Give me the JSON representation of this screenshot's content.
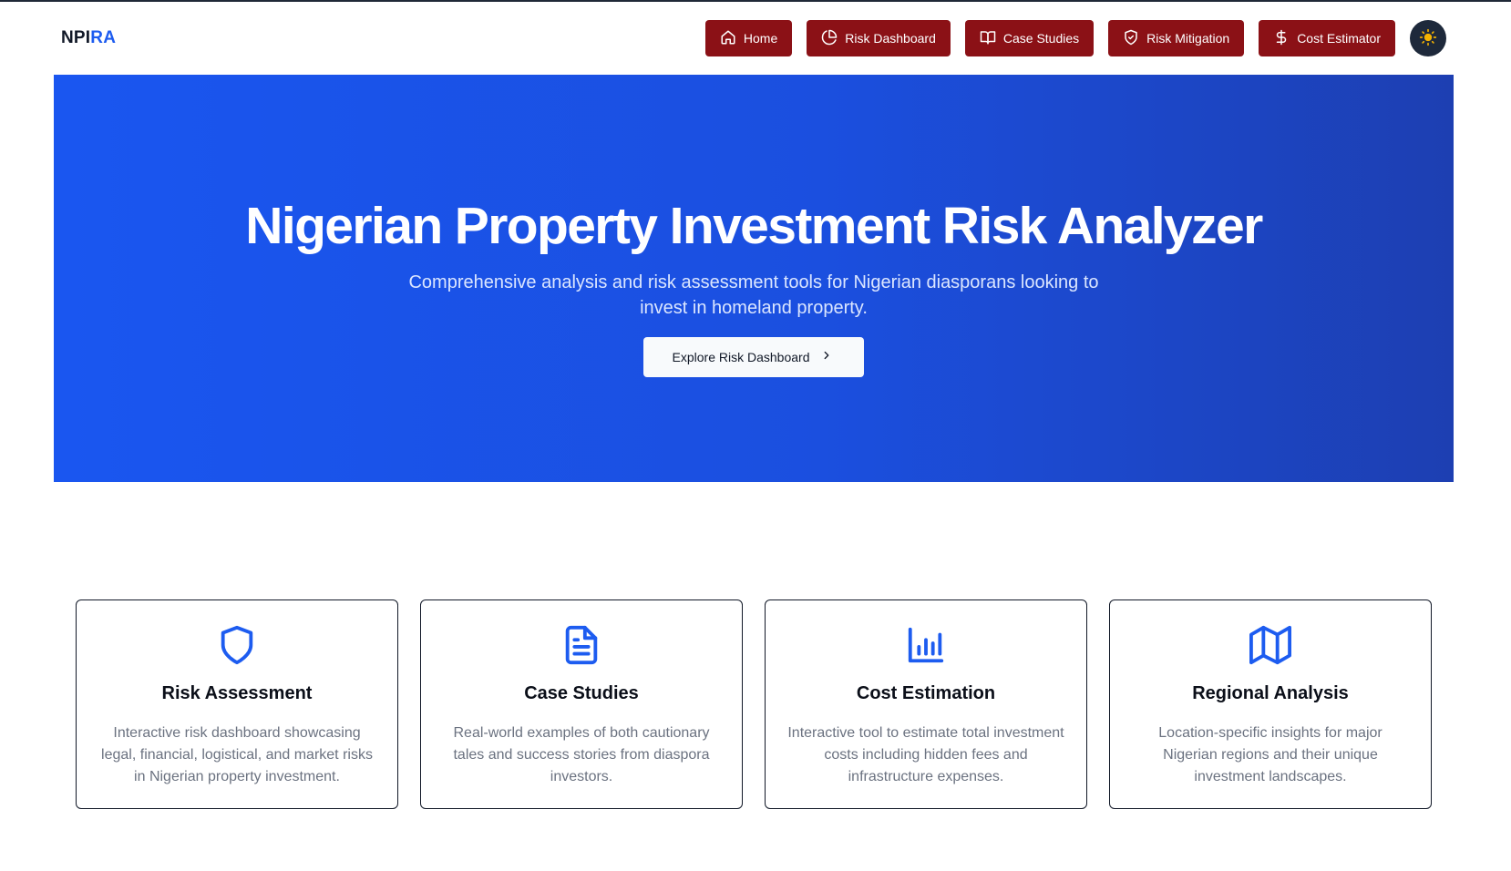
{
  "brand": {
    "part1": "NPI",
    "part2": "RA"
  },
  "nav": {
    "items": [
      {
        "label": "Home",
        "icon": "home-icon"
      },
      {
        "label": "Risk Dashboard",
        "icon": "pie-chart-icon"
      },
      {
        "label": "Case Studies",
        "icon": "book-open-icon"
      },
      {
        "label": "Risk Mitigation",
        "icon": "shield-check-icon"
      },
      {
        "label": "Cost Estimator",
        "icon": "dollar-sign-icon"
      }
    ],
    "theme_toggle_icon": "sun-icon"
  },
  "hero": {
    "title": "Nigerian Property Investment Risk Analyzer",
    "subtitle": "Comprehensive analysis and risk assessment tools for Nigerian diasporans looking to invest in homeland property.",
    "cta_label": "Explore Risk Dashboard",
    "cta_icon": "chevron-right-icon"
  },
  "features": [
    {
      "title": "Risk Assessment",
      "description": "Interactive risk dashboard showcasing legal, financial, logistical, and market risks in Nigerian property investment.",
      "icon": "shield-icon"
    },
    {
      "title": "Case Studies",
      "description": "Real-world examples of both cautionary tales and success stories from diaspora investors.",
      "icon": "file-text-icon"
    },
    {
      "title": "Cost Estimation",
      "description": "Interactive tool to estimate total investment costs including hidden fees and infrastructure expenses.",
      "icon": "bar-chart-icon"
    },
    {
      "title": "Regional Analysis",
      "description": "Location-specific insights for major Nigerian regions and their unique investment landscapes.",
      "icon": "map-icon"
    }
  ],
  "colors": {
    "nav_button": "#8b1116",
    "hero_gradient_start": "#1a56f0",
    "hero_gradient_end": "#1d3fb2",
    "accent": "#1d5cf0",
    "theme_button": "#1e293b",
    "sun": "#f5b301"
  }
}
